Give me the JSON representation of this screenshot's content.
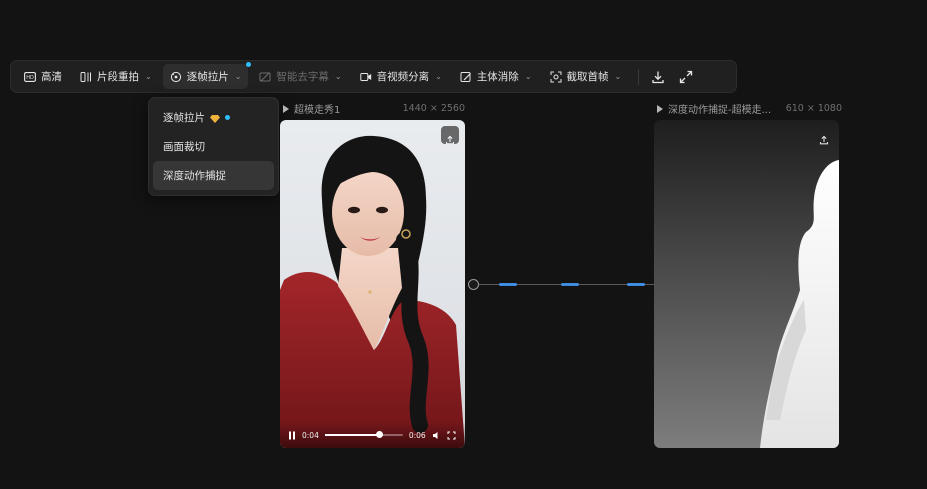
{
  "toolbar": {
    "hd": "高清",
    "reshoot": "片段重拍",
    "frame_by_frame": "逐帧拉片",
    "remove_subtitles": "智能去字幕",
    "audio_split": "音视频分离",
    "subject_removal": "主体消除",
    "capture_first_frame": "截取首帧"
  },
  "menu": {
    "items": [
      "逐帧拉片",
      "画面裁切",
      "深度动作捕捉"
    ]
  },
  "left_panel": {
    "title": "超模走秀1",
    "resolution": "1440 × 2560",
    "current_time": "0:04",
    "total_time": "0:06",
    "progress": 0.69
  },
  "right_panel": {
    "title": "深度动作捕捉-超模走...",
    "resolution": "610 × 1080"
  },
  "colors": {
    "accent_dot": "#2fc1ff",
    "connector_glow": "#3f9cff",
    "dress_red": "#8e1f22"
  },
  "icons": [
    "hd-icon",
    "scissors-icon",
    "film-frames-icon",
    "no-subtitle-icon",
    "audio-video-icon",
    "eraser-icon",
    "camera-capture-icon",
    "download-icon",
    "expand-icon",
    "upload-icon",
    "play-pause-icon",
    "volume-icon",
    "fullscreen-icon",
    "diamond-icon"
  ]
}
